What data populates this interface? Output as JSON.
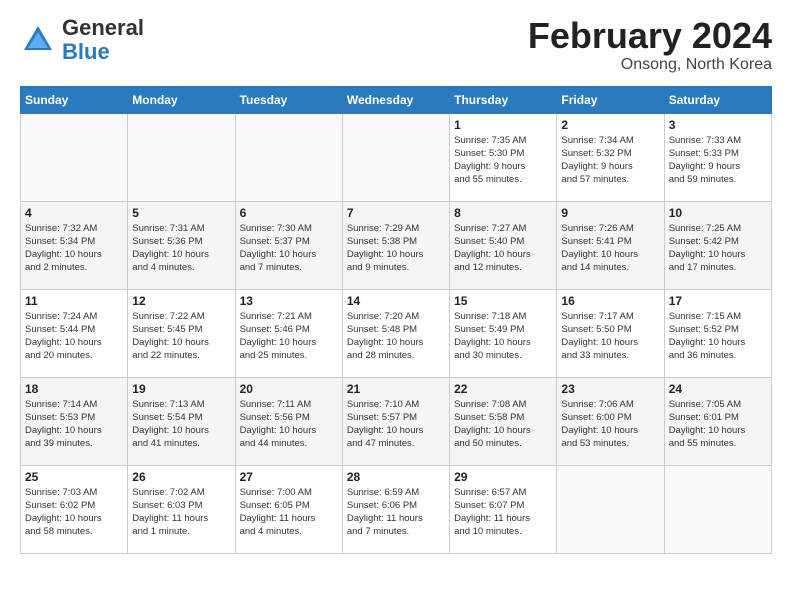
{
  "header": {
    "logo_general": "General",
    "logo_blue": "Blue",
    "title": "February 2024",
    "subtitle": "Onsong, North Korea"
  },
  "days_of_week": [
    "Sunday",
    "Monday",
    "Tuesday",
    "Wednesday",
    "Thursday",
    "Friday",
    "Saturday"
  ],
  "weeks": [
    [
      {
        "day": "",
        "info": ""
      },
      {
        "day": "",
        "info": ""
      },
      {
        "day": "",
        "info": ""
      },
      {
        "day": "",
        "info": ""
      },
      {
        "day": "1",
        "info": "Sunrise: 7:35 AM\nSunset: 5:30 PM\nDaylight: 9 hours\nand 55 minutes."
      },
      {
        "day": "2",
        "info": "Sunrise: 7:34 AM\nSunset: 5:32 PM\nDaylight: 9 hours\nand 57 minutes."
      },
      {
        "day": "3",
        "info": "Sunrise: 7:33 AM\nSunset: 5:33 PM\nDaylight: 9 hours\nand 59 minutes."
      }
    ],
    [
      {
        "day": "4",
        "info": "Sunrise: 7:32 AM\nSunset: 5:34 PM\nDaylight: 10 hours\nand 2 minutes."
      },
      {
        "day": "5",
        "info": "Sunrise: 7:31 AM\nSunset: 5:36 PM\nDaylight: 10 hours\nand 4 minutes."
      },
      {
        "day": "6",
        "info": "Sunrise: 7:30 AM\nSunset: 5:37 PM\nDaylight: 10 hours\nand 7 minutes."
      },
      {
        "day": "7",
        "info": "Sunrise: 7:29 AM\nSunset: 5:38 PM\nDaylight: 10 hours\nand 9 minutes."
      },
      {
        "day": "8",
        "info": "Sunrise: 7:27 AM\nSunset: 5:40 PM\nDaylight: 10 hours\nand 12 minutes."
      },
      {
        "day": "9",
        "info": "Sunrise: 7:26 AM\nSunset: 5:41 PM\nDaylight: 10 hours\nand 14 minutes."
      },
      {
        "day": "10",
        "info": "Sunrise: 7:25 AM\nSunset: 5:42 PM\nDaylight: 10 hours\nand 17 minutes."
      }
    ],
    [
      {
        "day": "11",
        "info": "Sunrise: 7:24 AM\nSunset: 5:44 PM\nDaylight: 10 hours\nand 20 minutes."
      },
      {
        "day": "12",
        "info": "Sunrise: 7:22 AM\nSunset: 5:45 PM\nDaylight: 10 hours\nand 22 minutes."
      },
      {
        "day": "13",
        "info": "Sunrise: 7:21 AM\nSunset: 5:46 PM\nDaylight: 10 hours\nand 25 minutes."
      },
      {
        "day": "14",
        "info": "Sunrise: 7:20 AM\nSunset: 5:48 PM\nDaylight: 10 hours\nand 28 minutes."
      },
      {
        "day": "15",
        "info": "Sunrise: 7:18 AM\nSunset: 5:49 PM\nDaylight: 10 hours\nand 30 minutes."
      },
      {
        "day": "16",
        "info": "Sunrise: 7:17 AM\nSunset: 5:50 PM\nDaylight: 10 hours\nand 33 minutes."
      },
      {
        "day": "17",
        "info": "Sunrise: 7:15 AM\nSunset: 5:52 PM\nDaylight: 10 hours\nand 36 minutes."
      }
    ],
    [
      {
        "day": "18",
        "info": "Sunrise: 7:14 AM\nSunset: 5:53 PM\nDaylight: 10 hours\nand 39 minutes."
      },
      {
        "day": "19",
        "info": "Sunrise: 7:13 AM\nSunset: 5:54 PM\nDaylight: 10 hours\nand 41 minutes."
      },
      {
        "day": "20",
        "info": "Sunrise: 7:11 AM\nSunset: 5:56 PM\nDaylight: 10 hours\nand 44 minutes."
      },
      {
        "day": "21",
        "info": "Sunrise: 7:10 AM\nSunset: 5:57 PM\nDaylight: 10 hours\nand 47 minutes."
      },
      {
        "day": "22",
        "info": "Sunrise: 7:08 AM\nSunset: 5:58 PM\nDaylight: 10 hours\nand 50 minutes."
      },
      {
        "day": "23",
        "info": "Sunrise: 7:06 AM\nSunset: 6:00 PM\nDaylight: 10 hours\nand 53 minutes."
      },
      {
        "day": "24",
        "info": "Sunrise: 7:05 AM\nSunset: 6:01 PM\nDaylight: 10 hours\nand 55 minutes."
      }
    ],
    [
      {
        "day": "25",
        "info": "Sunrise: 7:03 AM\nSunset: 6:02 PM\nDaylight: 10 hours\nand 58 minutes."
      },
      {
        "day": "26",
        "info": "Sunrise: 7:02 AM\nSunset: 6:03 PM\nDaylight: 11 hours\nand 1 minute."
      },
      {
        "day": "27",
        "info": "Sunrise: 7:00 AM\nSunset: 6:05 PM\nDaylight: 11 hours\nand 4 minutes."
      },
      {
        "day": "28",
        "info": "Sunrise: 6:59 AM\nSunset: 6:06 PM\nDaylight: 11 hours\nand 7 minutes."
      },
      {
        "day": "29",
        "info": "Sunrise: 6:57 AM\nSunset: 6:07 PM\nDaylight: 11 hours\nand 10 minutes."
      },
      {
        "day": "",
        "info": ""
      },
      {
        "day": "",
        "info": ""
      }
    ]
  ]
}
